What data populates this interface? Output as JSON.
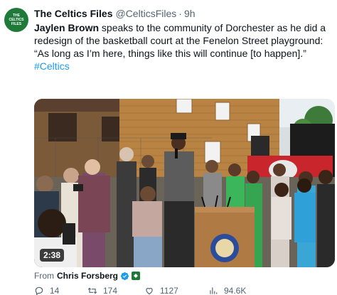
{
  "account": {
    "avatar_text": "THE CELTICS FILES",
    "display_name": "The Celtics Files",
    "handle": "@CelticsFiles",
    "separator": "·",
    "time": "9h"
  },
  "tweet": {
    "lead_name": "Jaylen Brown",
    "lead_rest": " speaks to the community of Dorchester as he did a redesign of the basketball court at the Fenelon Street  playground:",
    "quote": "“As long as I’m here, things like this will continue [to happen].”",
    "hashtag": "#Celtics"
  },
  "media": {
    "duration": "2:38",
    "podium_sign": "BOSTON"
  },
  "from": {
    "prefix": "From",
    "name": "Chris Forsberg"
  },
  "actions": {
    "replies": "14",
    "reposts": "174",
    "likes": "1127",
    "views": "94.6K"
  },
  "colors": {
    "accent": "#1d9bf0",
    "avatar_bg": "#1f7a3a",
    "muted": "#536471"
  },
  "icons": [
    "reply-icon",
    "repost-icon",
    "like-icon",
    "views-icon",
    "verified-badge-icon",
    "gold-badge-icon"
  ]
}
